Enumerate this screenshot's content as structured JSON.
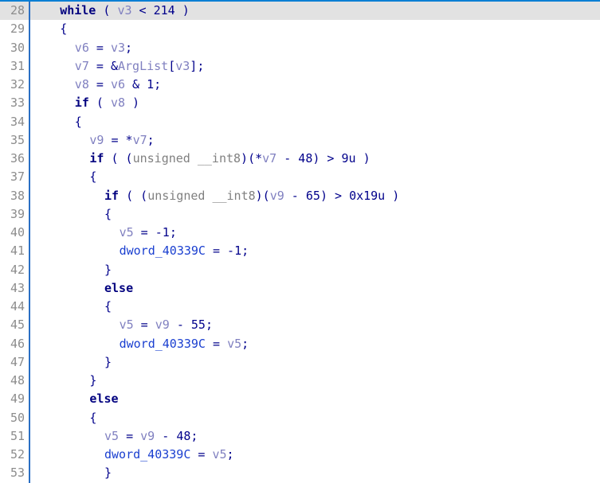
{
  "view": {
    "name": "pseudocode-view",
    "kind": "decompiler-pseudocode",
    "accent_color": "#0b7fd4",
    "background_color": "#ffffff",
    "current_line_highlight_color": "#e2e2e2",
    "gutter_separator_color": "#2a6fc4",
    "gutter_text_color": "#8c8c8c",
    "current_line_number": 28,
    "first_line_number": 28,
    "last_line_number": 53
  },
  "colors": {
    "plain": "#00008b",
    "keyword": "#00007f",
    "local_variable": "#8080c0",
    "global_variable": "#1a3fd0",
    "type": "#808080"
  },
  "lines": [
    {
      "number": "28",
      "current": true,
      "indent": 4,
      "tokens": [
        {
          "t": "while",
          "c": "keyword"
        },
        {
          "t": " ( ",
          "c": "plain"
        },
        {
          "t": "v3",
          "c": "lvar"
        },
        {
          "t": " < ",
          "c": "plain"
        },
        {
          "t": "214",
          "c": "number"
        },
        {
          "t": " )",
          "c": "plain"
        }
      ]
    },
    {
      "number": "29",
      "current": false,
      "indent": 4,
      "tokens": [
        {
          "t": "{",
          "c": "plain"
        }
      ]
    },
    {
      "number": "30",
      "current": false,
      "indent": 6,
      "tokens": [
        {
          "t": "v6",
          "c": "lvar"
        },
        {
          "t": " = ",
          "c": "plain"
        },
        {
          "t": "v3",
          "c": "lvar"
        },
        {
          "t": ";",
          "c": "plain"
        }
      ]
    },
    {
      "number": "31",
      "current": false,
      "indent": 6,
      "tokens": [
        {
          "t": "v7",
          "c": "lvar"
        },
        {
          "t": " = &",
          "c": "plain"
        },
        {
          "t": "ArgList",
          "c": "lvar"
        },
        {
          "t": "[",
          "c": "plain"
        },
        {
          "t": "v3",
          "c": "lvar"
        },
        {
          "t": "];",
          "c": "plain"
        }
      ]
    },
    {
      "number": "32",
      "current": false,
      "indent": 6,
      "tokens": [
        {
          "t": "v8",
          "c": "lvar"
        },
        {
          "t": " = ",
          "c": "plain"
        },
        {
          "t": "v6",
          "c": "lvar"
        },
        {
          "t": " & ",
          "c": "plain"
        },
        {
          "t": "1",
          "c": "number"
        },
        {
          "t": ";",
          "c": "plain"
        }
      ]
    },
    {
      "number": "33",
      "current": false,
      "indent": 6,
      "tokens": [
        {
          "t": "if",
          "c": "keyword"
        },
        {
          "t": " ( ",
          "c": "plain"
        },
        {
          "t": "v8",
          "c": "lvar"
        },
        {
          "t": " )",
          "c": "plain"
        }
      ]
    },
    {
      "number": "34",
      "current": false,
      "indent": 6,
      "tokens": [
        {
          "t": "{",
          "c": "plain"
        }
      ]
    },
    {
      "number": "35",
      "current": false,
      "indent": 8,
      "tokens": [
        {
          "t": "v9",
          "c": "lvar"
        },
        {
          "t": " = *",
          "c": "plain"
        },
        {
          "t": "v7",
          "c": "lvar"
        },
        {
          "t": ";",
          "c": "plain"
        }
      ]
    },
    {
      "number": "36",
      "current": false,
      "indent": 8,
      "tokens": [
        {
          "t": "if",
          "c": "keyword"
        },
        {
          "t": " ( (",
          "c": "plain"
        },
        {
          "t": "unsigned __int8",
          "c": "type"
        },
        {
          "t": ")(*",
          "c": "plain"
        },
        {
          "t": "v7",
          "c": "lvar"
        },
        {
          "t": " - ",
          "c": "plain"
        },
        {
          "t": "48",
          "c": "number"
        },
        {
          "t": ") > ",
          "c": "plain"
        },
        {
          "t": "9u",
          "c": "number"
        },
        {
          "t": " )",
          "c": "plain"
        }
      ]
    },
    {
      "number": "37",
      "current": false,
      "indent": 8,
      "tokens": [
        {
          "t": "{",
          "c": "plain"
        }
      ]
    },
    {
      "number": "38",
      "current": false,
      "indent": 10,
      "tokens": [
        {
          "t": "if",
          "c": "keyword"
        },
        {
          "t": " ( (",
          "c": "plain"
        },
        {
          "t": "unsigned __int8",
          "c": "type"
        },
        {
          "t": ")(",
          "c": "plain"
        },
        {
          "t": "v9",
          "c": "lvar"
        },
        {
          "t": " - ",
          "c": "plain"
        },
        {
          "t": "65",
          "c": "number"
        },
        {
          "t": ") > ",
          "c": "plain"
        },
        {
          "t": "0x19u",
          "c": "number"
        },
        {
          "t": " )",
          "c": "plain"
        }
      ]
    },
    {
      "number": "39",
      "current": false,
      "indent": 10,
      "tokens": [
        {
          "t": "{",
          "c": "plain"
        }
      ]
    },
    {
      "number": "40",
      "current": false,
      "indent": 12,
      "tokens": [
        {
          "t": "v5",
          "c": "lvar"
        },
        {
          "t": " = -",
          "c": "plain"
        },
        {
          "t": "1",
          "c": "number"
        },
        {
          "t": ";",
          "c": "plain"
        }
      ]
    },
    {
      "number": "41",
      "current": false,
      "indent": 12,
      "tokens": [
        {
          "t": "dword_40339C",
          "c": "gvar"
        },
        {
          "t": " = -",
          "c": "plain"
        },
        {
          "t": "1",
          "c": "number"
        },
        {
          "t": ";",
          "c": "plain"
        }
      ]
    },
    {
      "number": "42",
      "current": false,
      "indent": 10,
      "tokens": [
        {
          "t": "}",
          "c": "plain"
        }
      ]
    },
    {
      "number": "43",
      "current": false,
      "indent": 10,
      "tokens": [
        {
          "t": "else",
          "c": "keyword"
        }
      ]
    },
    {
      "number": "44",
      "current": false,
      "indent": 10,
      "tokens": [
        {
          "t": "{",
          "c": "plain"
        }
      ]
    },
    {
      "number": "45",
      "current": false,
      "indent": 12,
      "tokens": [
        {
          "t": "v5",
          "c": "lvar"
        },
        {
          "t": " = ",
          "c": "plain"
        },
        {
          "t": "v9",
          "c": "lvar"
        },
        {
          "t": " - ",
          "c": "plain"
        },
        {
          "t": "55",
          "c": "number"
        },
        {
          "t": ";",
          "c": "plain"
        }
      ]
    },
    {
      "number": "46",
      "current": false,
      "indent": 12,
      "tokens": [
        {
          "t": "dword_40339C",
          "c": "gvar"
        },
        {
          "t": " = ",
          "c": "plain"
        },
        {
          "t": "v5",
          "c": "lvar"
        },
        {
          "t": ";",
          "c": "plain"
        }
      ]
    },
    {
      "number": "47",
      "current": false,
      "indent": 10,
      "tokens": [
        {
          "t": "}",
          "c": "plain"
        }
      ]
    },
    {
      "number": "48",
      "current": false,
      "indent": 8,
      "tokens": [
        {
          "t": "}",
          "c": "plain"
        }
      ]
    },
    {
      "number": "49",
      "current": false,
      "indent": 8,
      "tokens": [
        {
          "t": "else",
          "c": "keyword"
        }
      ]
    },
    {
      "number": "50",
      "current": false,
      "indent": 8,
      "tokens": [
        {
          "t": "{",
          "c": "plain"
        }
      ]
    },
    {
      "number": "51",
      "current": false,
      "indent": 10,
      "tokens": [
        {
          "t": "v5",
          "c": "lvar"
        },
        {
          "t": " = ",
          "c": "plain"
        },
        {
          "t": "v9",
          "c": "lvar"
        },
        {
          "t": " - ",
          "c": "plain"
        },
        {
          "t": "48",
          "c": "number"
        },
        {
          "t": ";",
          "c": "plain"
        }
      ]
    },
    {
      "number": "52",
      "current": false,
      "indent": 10,
      "tokens": [
        {
          "t": "dword_40339C",
          "c": "gvar"
        },
        {
          "t": " = ",
          "c": "plain"
        },
        {
          "t": "v5",
          "c": "lvar"
        },
        {
          "t": ";",
          "c": "plain"
        }
      ]
    },
    {
      "number": "53",
      "current": false,
      "indent": 10,
      "tokens": [
        {
          "t": "}",
          "c": "plain"
        }
      ]
    }
  ]
}
